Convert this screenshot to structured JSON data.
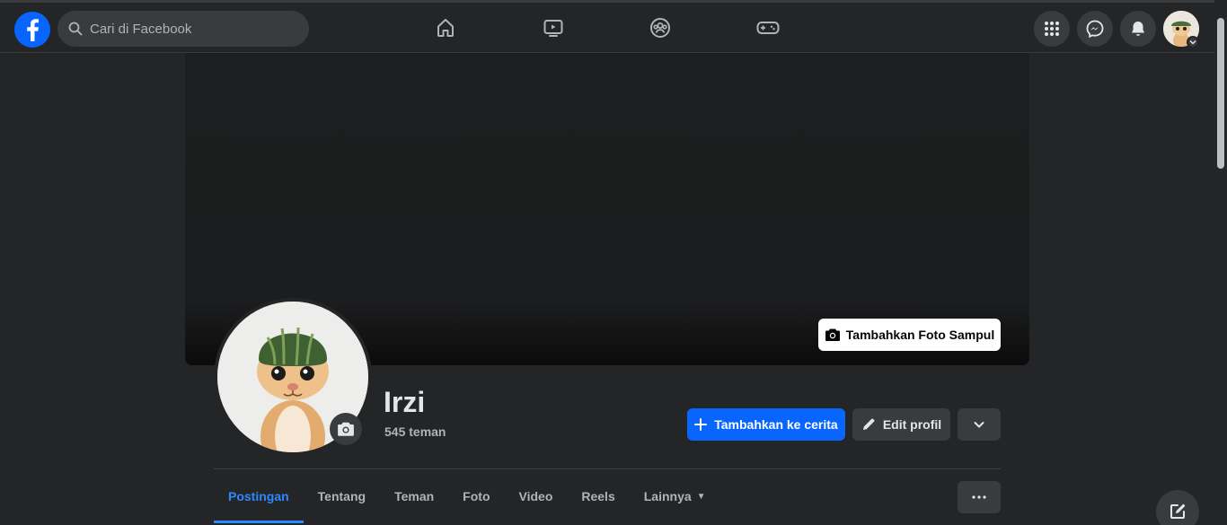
{
  "navbar": {
    "search_placeholder": "Cari di Facebook",
    "nav_icons": [
      "home-icon",
      "video-icon",
      "groups-icon",
      "gaming-icon"
    ],
    "right_icons": [
      "menu-grid-icon",
      "messenger-icon",
      "bell-icon"
    ]
  },
  "cover": {
    "add_cover_label": "Tambahkan Foto Sampul"
  },
  "profile": {
    "name": "Irzi",
    "friends": "545 teman"
  },
  "actions": {
    "add_story_label": "Tambahkan ke cerita",
    "edit_profile_label": "Edit profil"
  },
  "tabs": [
    {
      "label": "Postingan",
      "active": true
    },
    {
      "label": "Tentang"
    },
    {
      "label": "Teman"
    },
    {
      "label": "Foto"
    },
    {
      "label": "Video"
    },
    {
      "label": "Reels"
    },
    {
      "label": "Lainnya"
    }
  ],
  "colors": {
    "accent": "#0866ff",
    "active_tab": "#2d88ff",
    "background": "#18191a",
    "surface": "#242526"
  }
}
